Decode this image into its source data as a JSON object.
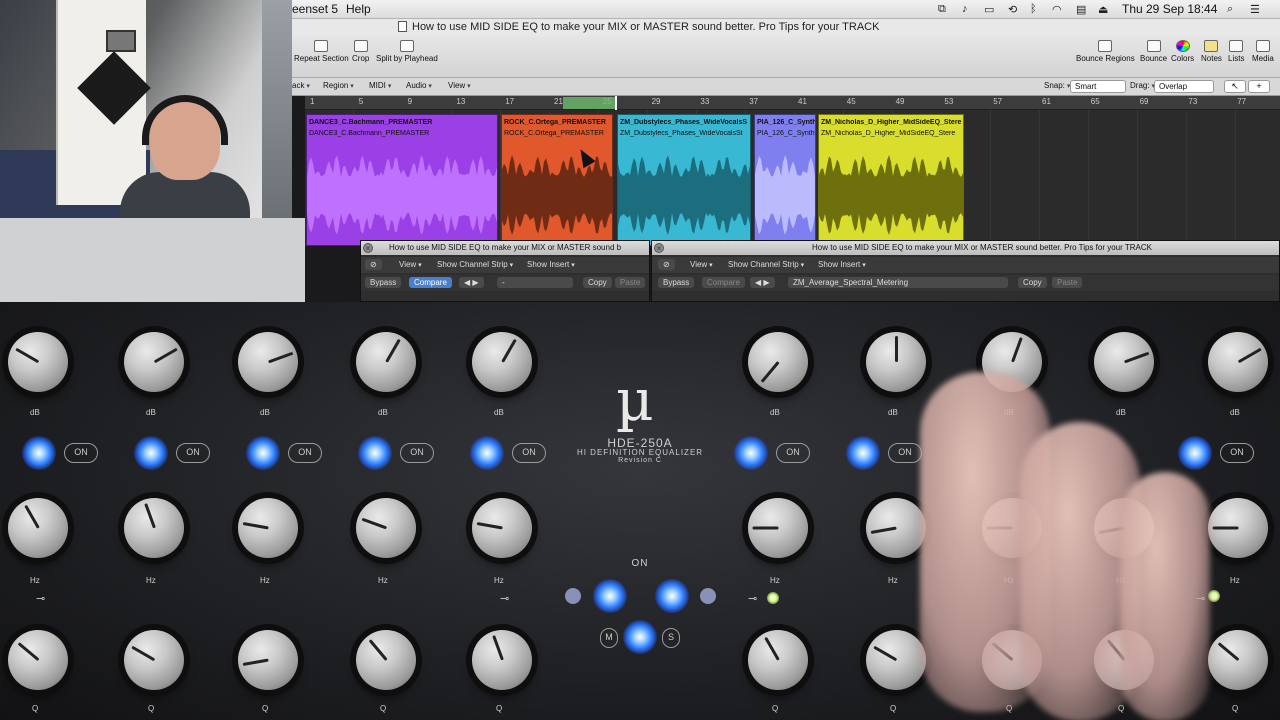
{
  "menubar": {
    "app_menu": "eenset 5",
    "help": "Help",
    "datetime": "Thu 29 Sep  18:44"
  },
  "window": {
    "title": "How to use MID SIDE EQ to make your MIX or MASTER sound better. Pro Tips for your TRACK"
  },
  "toolbar": {
    "repeat_section": "Repeat Section",
    "crop": "Crop",
    "split_by_playhead": "Split by Playhead",
    "bounce_regions": "Bounce Regions",
    "bounce": "Bounce",
    "colors": "Colors",
    "notes": "Notes",
    "lists": "Lists",
    "media": "Media"
  },
  "track_menubar": {
    "track": "ack",
    "region": "Region",
    "midi": "MIDI",
    "audio": "Audio",
    "view": "View",
    "snap_label": "Snap:",
    "snap_value": "Smart",
    "drag_label": "Drag:",
    "drag_value": "Overlap"
  },
  "ruler": {
    "ticks": [
      "1",
      "5",
      "9",
      "13",
      "17",
      "21",
      "25",
      "29",
      "33",
      "37",
      "41",
      "45",
      "49",
      "53",
      "57",
      "61",
      "65",
      "69",
      "73",
      "77"
    ]
  },
  "regions": [
    {
      "name": "DANCE3_C.Bachmann_PREMASTER",
      "sub": "DANCE3_C.Bachmann_PREMASTER",
      "color": "#9b3fe6",
      "wave": "#c47aff"
    },
    {
      "name": "ROCK_C.Ortega_PREMASTER",
      "sub": "ROCK_C.Ortega_PREMASTER",
      "color": "#e0582c",
      "wave": "#5a2310"
    },
    {
      "name": "ZM_Dubstylecs_Phases_WideVocalsS",
      "sub": "ZM_Dubstylecs_Phases_WideVocalsSt",
      "color": "#39b8d4",
      "wave": "#17606f"
    },
    {
      "name": "PIA_126_C_Synth",
      "sub": "PIA_126_C_Synth",
      "color": "#7f7ff0",
      "wave": "#c4c4ff"
    },
    {
      "name": "ZM_Nicholas_D_Higher_MidSideEQ_Stere",
      "sub": "ZM_Nicholas_D_Higher_MidSideEQ_Stere",
      "color": "#d9de2c",
      "wave": "#5b5d08"
    }
  ],
  "plugin_left": {
    "title": "How to use MID SIDE EQ to make your MIX or MASTER sound b",
    "view": "View",
    "show_channel_strip": "Show Channel Strip",
    "show_insert": "Show Insert",
    "bypass": "Bypass",
    "compare": "Compare",
    "preset": "-",
    "copy": "Copy",
    "paste": "Paste"
  },
  "plugin_right": {
    "title": "How to use MID SIDE EQ to make your MIX or MASTER sound better. Pro Tips for your TRACK",
    "view": "View",
    "show_channel_strip": "Show Channel Strip",
    "show_insert": "Show Insert",
    "bypass": "Bypass",
    "compare": "Compare",
    "preset": "ZM_Average_Spectral_Metering",
    "copy": "Copy",
    "paste": "Paste"
  },
  "hardware": {
    "logo": "µ",
    "model": "HDE-250A",
    "subtitle": "HI DEFINITION EQUALIZER",
    "revision": "Revision C",
    "on_label": "ON",
    "m_label": "M",
    "s_label": "S",
    "db_label": "dB",
    "hz_label": "Hz",
    "q_label": "Q"
  }
}
